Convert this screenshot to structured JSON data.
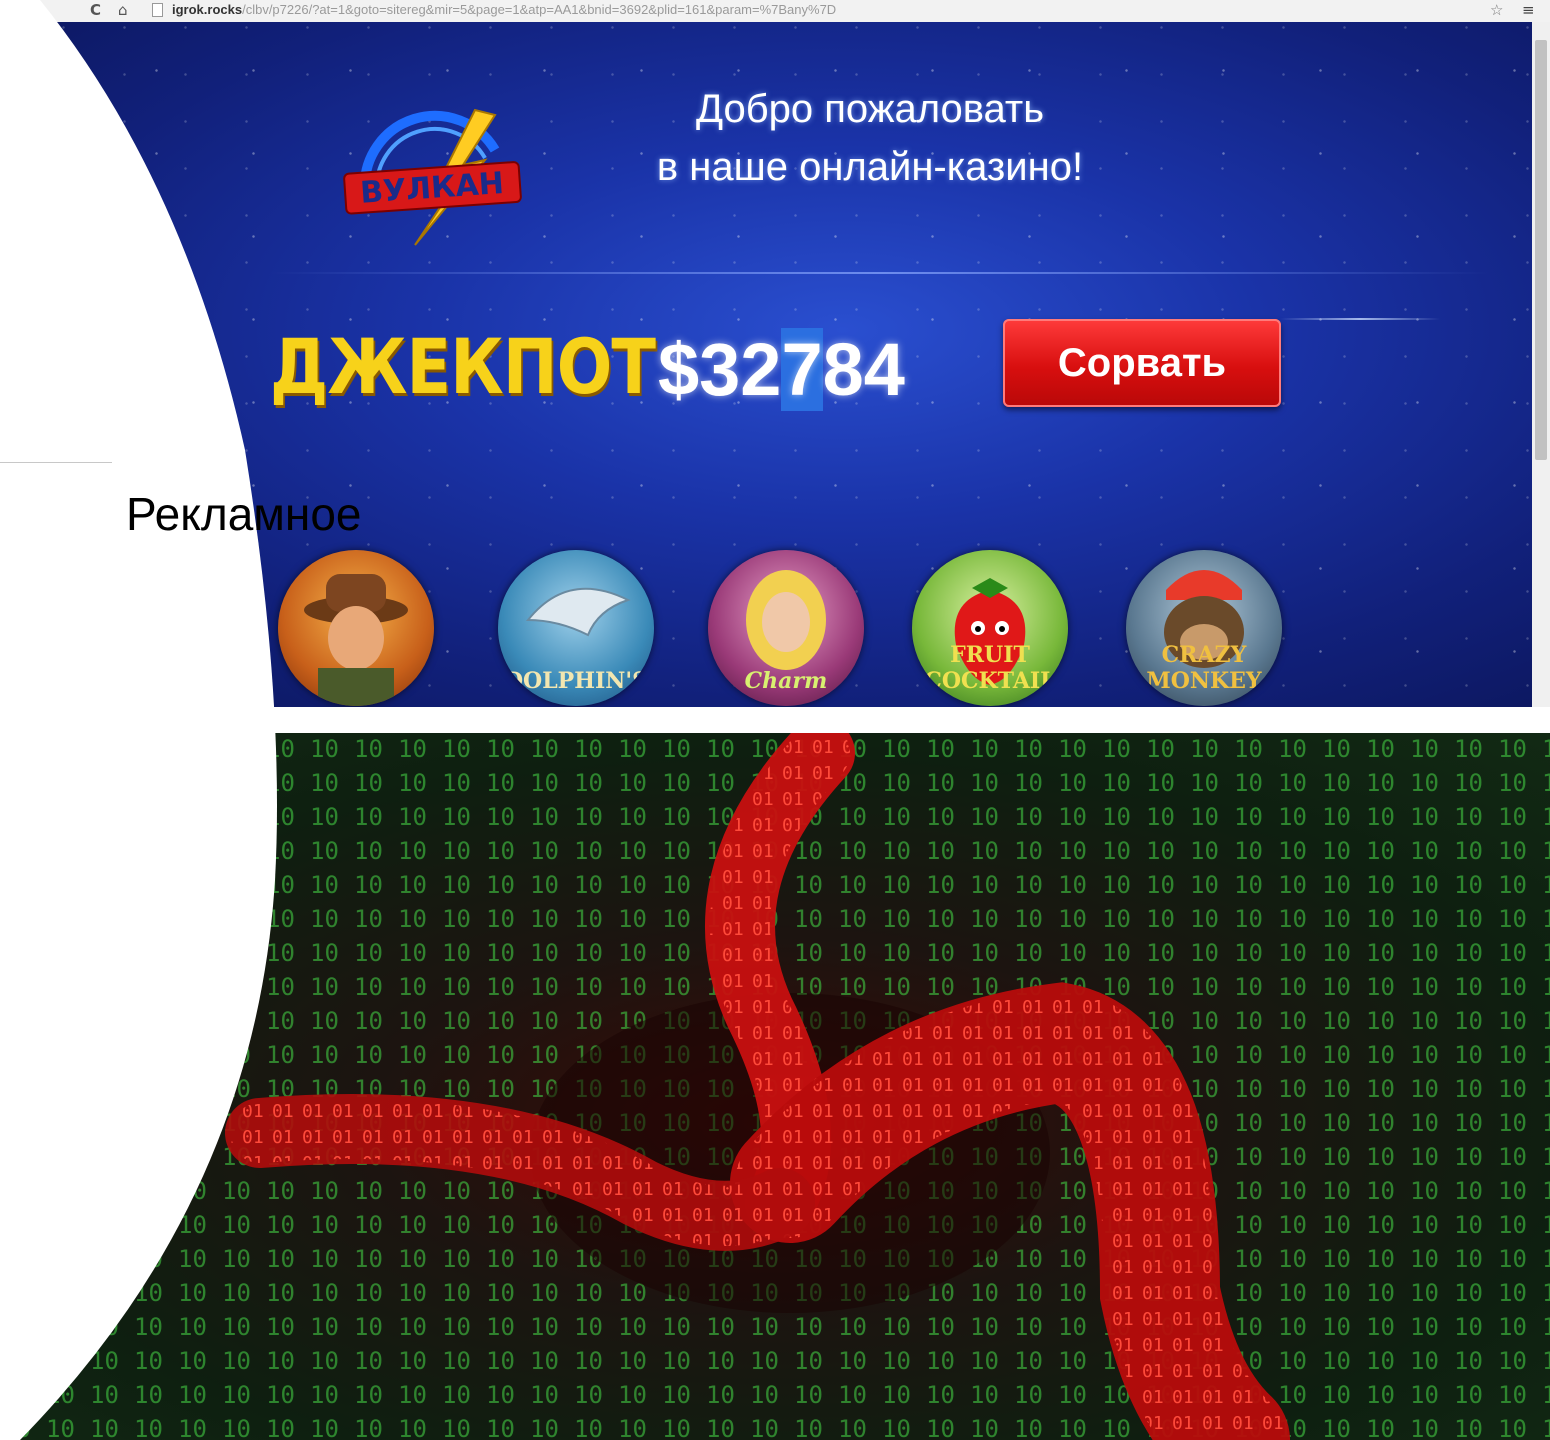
{
  "browser": {
    "url_domain": "igrok.rocks",
    "url_path": "/clbv/p7226/?at=1&goto=sitereg&mir=5&page=1&atp=AA1&bnid=3692&plid=161&param=%7Bany%7D",
    "back_icon": "back-arrow-icon",
    "forward_icon": "forward-arrow-icon",
    "reload_icon": "reload-icon",
    "home_icon": "home-icon",
    "star_icon": "star-icon",
    "menu_icon": "menu-icon"
  },
  "casino": {
    "logo_text": "ВУЛКАН",
    "welcome_line1": "Добро пожаловать",
    "welcome_line2": "в наше онлайн-казино!",
    "jackpot_label": "ДЖЕКПОТ",
    "jackpot_prefix": "$32",
    "jackpot_highlight": "7",
    "jackpot_suffix": "84",
    "grab_button": "Сорвать",
    "games": [
      {
        "caption": ""
      },
      {
        "caption": "DOLPHIN'S"
      },
      {
        "caption": "Charm"
      },
      {
        "caption": "FRUIT COCKTAIL"
      },
      {
        "caption": "CRAZY MONKEY"
      }
    ]
  },
  "slide": {
    "ad_label": "Рекламное"
  },
  "colors": {
    "casino_bg": "#1a33a8",
    "jackpot_gold": "#f7d21a",
    "button_red": "#d80f0f",
    "binary_green": "#3fbf3f",
    "binary_red": "#e02020"
  }
}
